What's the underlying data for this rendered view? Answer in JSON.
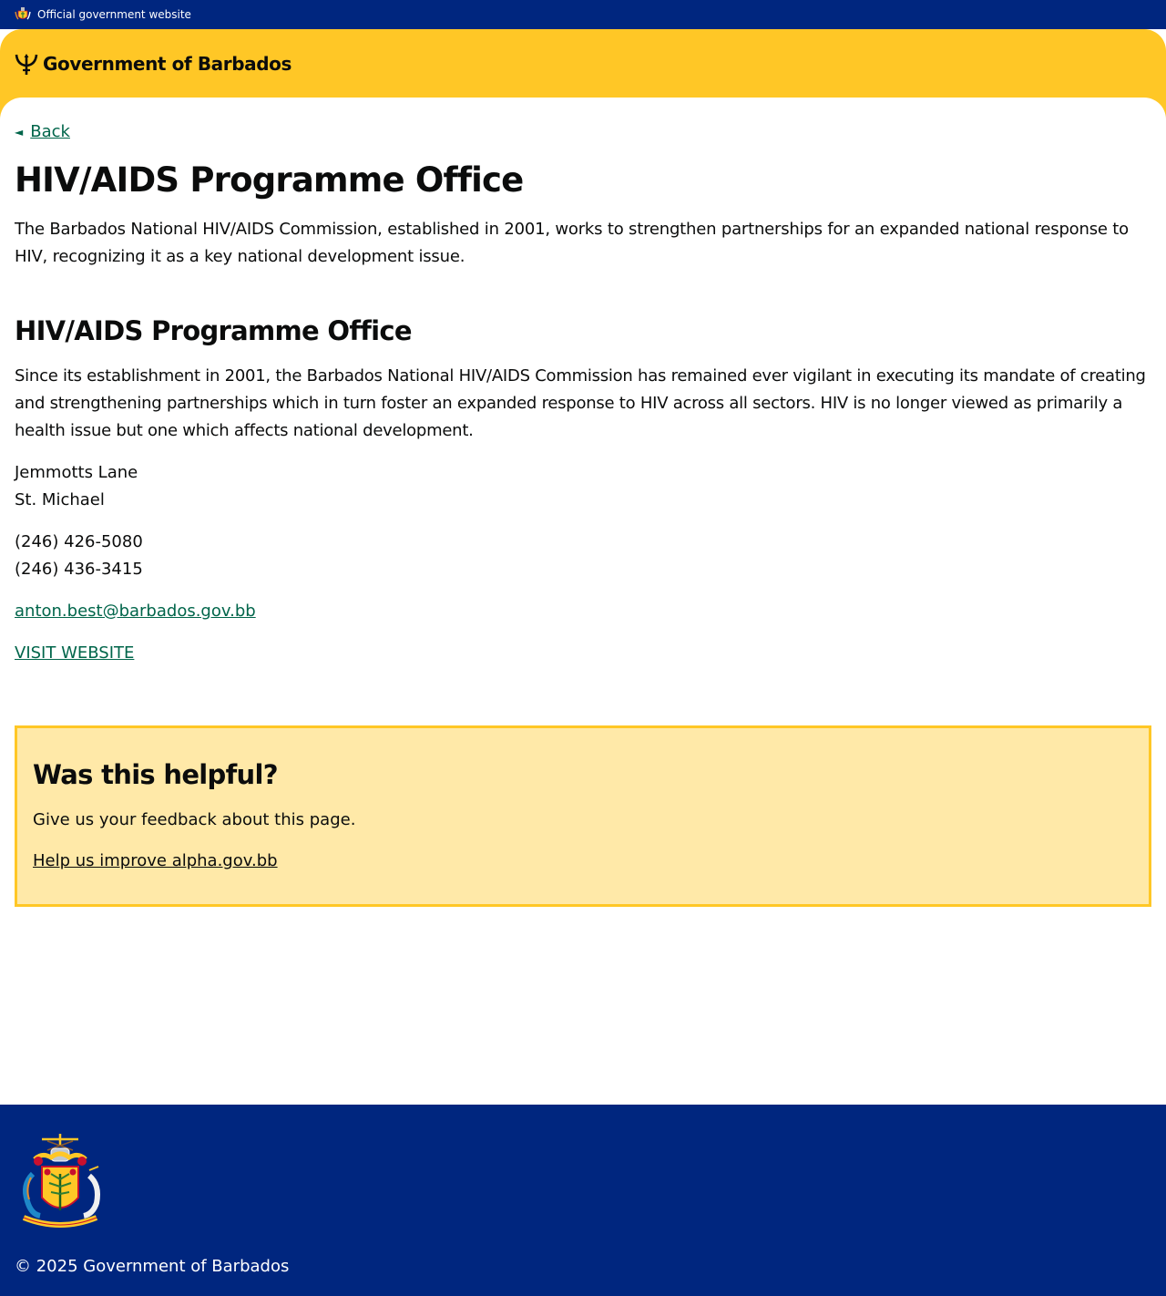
{
  "topbar": {
    "official_label": "Official government website",
    "icon": "coat-of-arms-icon"
  },
  "header": {
    "brand_name": "Government of Barbados",
    "icon": "trident-icon",
    "colors": {
      "banner": "#ffc726",
      "topbar": "#00267f"
    }
  },
  "nav": {
    "back_label": "Back",
    "back_icon": "arrow-left-icon"
  },
  "page": {
    "title": "HIV/AIDS Programme Office",
    "intro": "The Barbados National HIV/AIDS Commission, established in 2001, works to strengthen partnerships for an expanded national response to HIV, recognizing it as a key national development issue."
  },
  "section": {
    "title": "HIV/AIDS Programme Office",
    "description": "Since its establishment in 2001, the Barbados National HIV/AIDS Commission has remained ever vigilant in executing its mandate of creating and strengthening partnerships which in turn foster an expanded response to HIV across all sectors. HIV is no longer viewed as primarily a health issue but one which affects national development.",
    "address": [
      "Jemmotts Lane",
      "St. Michael"
    ],
    "phones": [
      "(246) 426-5080",
      "(246) 436-3415"
    ],
    "email": "anton.best@barbados.gov.bb",
    "website_label": "VISIT WEBSITE",
    "link_color": "#00654a"
  },
  "feedback": {
    "title": "Was this helpful?",
    "text": "Give us your feedback about this page.",
    "link_label": "Help us improve alpha.gov.bb",
    "colors": {
      "background": "#ffe9a8",
      "border": "#ffc726"
    }
  },
  "footer": {
    "copyright": "© 2025 Government of Barbados",
    "icon": "coat-of-arms-icon"
  }
}
